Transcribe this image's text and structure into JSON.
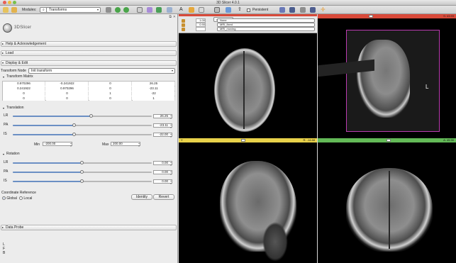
{
  "window": {
    "title": "3D Slicer 4.0.1"
  },
  "toolbar": {
    "modules_label": "Modules:",
    "module_value": "Transforms",
    "persistent_label": "Persistent"
  },
  "app": {
    "logo_text": "3DSlicer"
  },
  "sections": {
    "help": "Help & Acknowledgement",
    "load": "Load",
    "display": "Display & Edit",
    "data_probe": "Data Probe"
  },
  "transform": {
    "node_label": "Transform Node",
    "node_value": "Init transform",
    "matrix_title": "Transform Matrix",
    "matrix": [
      [
        "0.970296",
        "-0.241922",
        "0",
        "26.25"
      ],
      [
        "0.241922",
        "0.970296",
        "0",
        "-23.11"
      ],
      [
        "0",
        "0",
        "1",
        "-22"
      ],
      [
        "0",
        "0",
        "0",
        "1"
      ]
    ]
  },
  "translation": {
    "title": "Translation",
    "sliders": [
      {
        "label": "LR",
        "value": "26.25",
        "fraction": 0.566
      },
      {
        "label": "PA",
        "value": "-23.11",
        "fraction": 0.442
      },
      {
        "label": "IS",
        "value": "-22.00",
        "fraction": 0.445
      }
    ],
    "min_label": "Min",
    "min_value": "-200.00",
    "max_label": "Max",
    "max_value": "200.00"
  },
  "rotation": {
    "title": "Rotation",
    "sliders": [
      {
        "label": "LR",
        "value": "0.00",
        "fraction": 0.5
      },
      {
        "label": "PA",
        "value": "0.00",
        "fraction": 0.5
      },
      {
        "label": "IS",
        "value": "0.00",
        "fraction": 0.5
      }
    ]
  },
  "coord_ref": {
    "title": "Coordinate Reference",
    "global": "Global",
    "local": "Local",
    "selected": "global"
  },
  "buttons": {
    "identity": "Identity",
    "revert": "Revert"
  },
  "probe": {
    "lines": [
      "L",
      "F",
      "B"
    ]
  },
  "views": {
    "red": {
      "orientation": "Axial",
      "rows": [
        {
          "opacity": "1.00",
          "node": "None"
        },
        {
          "opacity": "0.90",
          "node": "MRI_fixed"
        },
        {
          "opacity": "",
          "node": "MRI_moving"
        }
      ],
      "slider_label": "R: -14.68",
      "color": "#f6c940"
    },
    "yellow": {
      "label": "Y",
      "color": "#e8d14a"
    },
    "green": {
      "slider_label": "A: 45.30",
      "color": "#63b957"
    },
    "red_top_label": "S: 43.93",
    "three_d_label": "L"
  },
  "colors": {
    "accent": "#6b8fc4",
    "red": "#d84a3a",
    "yellow": "#e8d14a",
    "green": "#63b957"
  }
}
